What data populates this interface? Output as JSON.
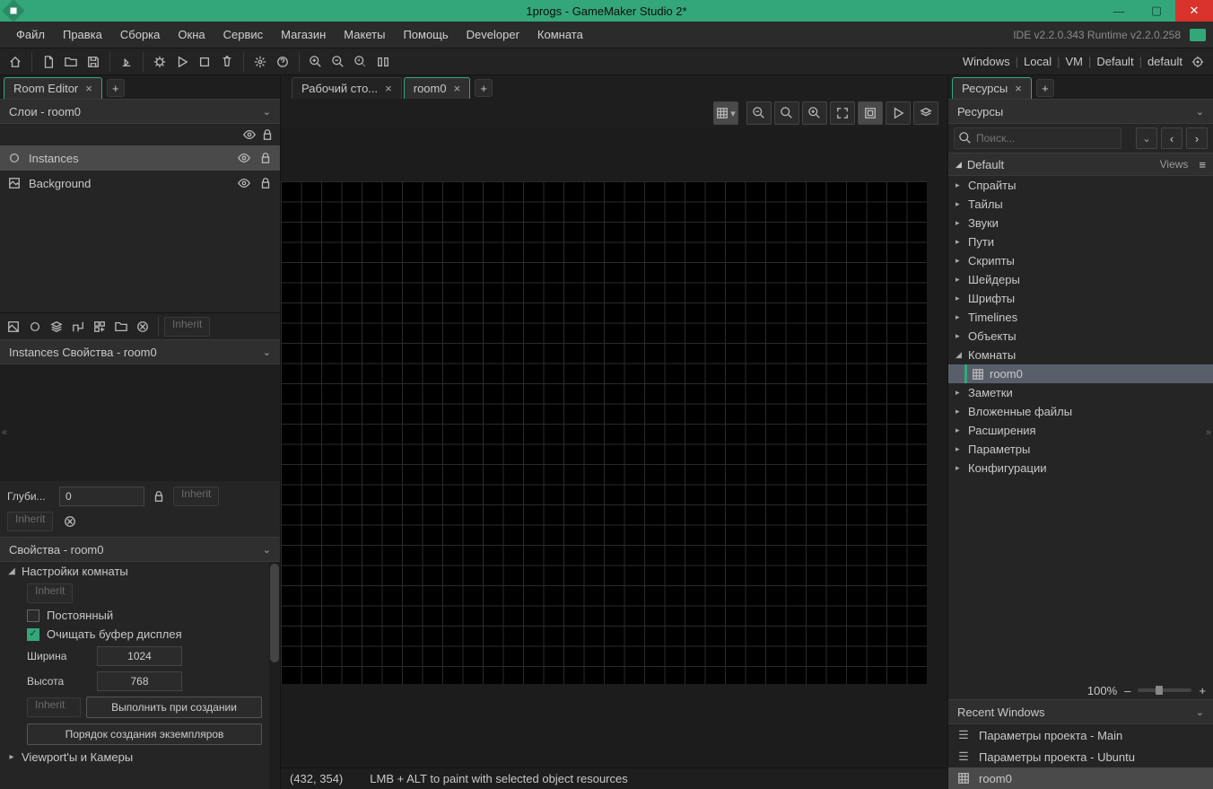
{
  "window": {
    "title": "1progs - GameMaker Studio 2*"
  },
  "menubar": {
    "items": [
      "Файл",
      "Правка",
      "Сборка",
      "Окна",
      "Сервис",
      "Магазин",
      "Макеты",
      "Помощь",
      "Developer",
      "Комната"
    ],
    "runtime": "IDE v2.2.0.343 Runtime v2.2.0.258"
  },
  "toolbar_right": {
    "items": [
      "Windows",
      "Local",
      "VM",
      "Default",
      "default"
    ]
  },
  "left": {
    "tab": "Room Editor",
    "layers_header": "Слои - room0",
    "layers": [
      {
        "name": "Instances",
        "selected": true
      },
      {
        "name": "Background",
        "selected": false
      }
    ],
    "inherit_label": "Inherit",
    "instances_props_header": "Instances Свойства - room0",
    "depth_label": "Глуби...",
    "depth_value": "0",
    "inherit2": "Inherit",
    "inherit3": "Inherit",
    "room_props_header": "Свойства - room0",
    "room_settings_label": "Настройки комнаты",
    "room_inherit": "Inherit",
    "persistent_label": "Постоянный",
    "clear_buffer_label": "Очищать буфер дисплея",
    "width_label": "Ширина",
    "width_value": "1024",
    "height_label": "Высота",
    "height_value": "768",
    "inherit4": "Inherit",
    "creation_code": "Выполнить при создании",
    "instance_order": "Порядок создания экземпляров",
    "viewports_label": "Viewport'ы и Камеры"
  },
  "center": {
    "tabs": [
      {
        "label": "Рабочий сто...",
        "active": false
      },
      {
        "label": "room0",
        "active": true
      }
    ],
    "status_coords": "(432, 354)",
    "status_hint": "LMB + ALT to paint with selected object resources"
  },
  "right": {
    "tab": "Ресурсы",
    "header": "Ресурсы",
    "search_placeholder": "Поиск...",
    "default_label": "Default",
    "views_label": "Views",
    "resources": [
      {
        "label": "Спрайты"
      },
      {
        "label": "Тайлы"
      },
      {
        "label": "Звуки"
      },
      {
        "label": "Пути"
      },
      {
        "label": "Скрипты"
      },
      {
        "label": "Шейдеры"
      },
      {
        "label": "Шрифты"
      },
      {
        "label": "Timelines"
      },
      {
        "label": "Объекты"
      },
      {
        "label": "Комнаты",
        "expanded": true,
        "children": [
          {
            "label": "room0",
            "selected": true
          }
        ]
      },
      {
        "label": "Заметки"
      },
      {
        "label": "Вложенные файлы"
      },
      {
        "label": "Расширения"
      },
      {
        "label": "Параметры"
      },
      {
        "label": "Конфигурации"
      }
    ],
    "zoom": "100%",
    "recent_header": "Recent Windows",
    "recent": [
      {
        "label": "Параметры проекта - Main",
        "selected": false
      },
      {
        "label": "Параметры проекта - Ubuntu",
        "selected": false
      },
      {
        "label": "room0",
        "selected": true
      }
    ]
  }
}
